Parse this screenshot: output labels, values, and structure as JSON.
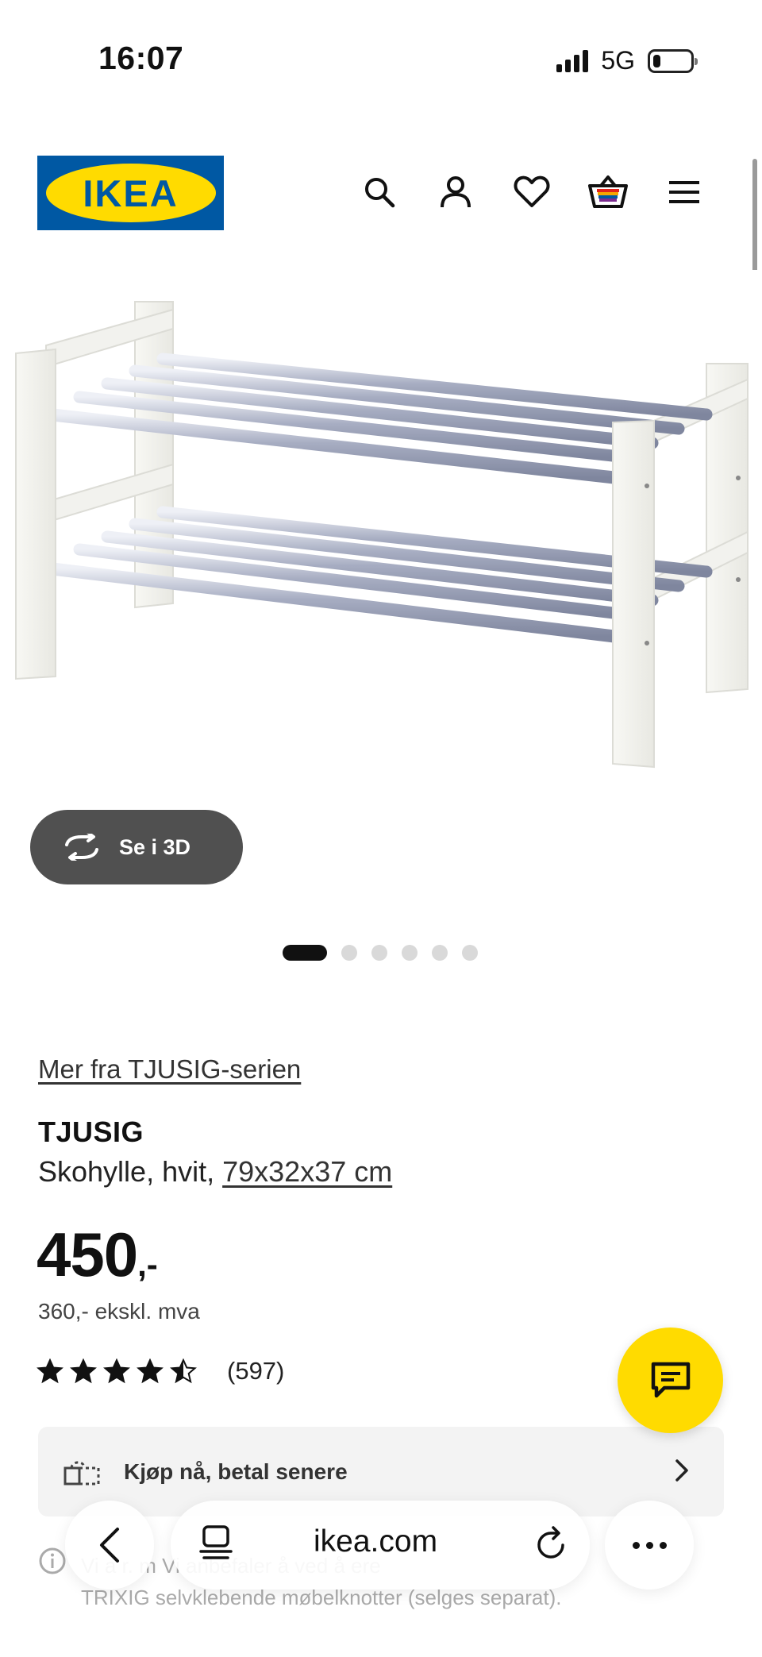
{
  "status_bar": {
    "time": "16:07",
    "network": "5G",
    "signal_bars": 4,
    "battery_level_percent": 20
  },
  "header": {
    "logo_text": "IKEA",
    "icons": [
      "search-icon",
      "profile-icon",
      "heart-icon",
      "basket-icon",
      "menu-icon"
    ]
  },
  "colors": {
    "brand_blue": "#0058a3",
    "brand_yellow": "#ffdb00",
    "button_dark": "#505050"
  },
  "gallery": {
    "see_3d_label": "Se i 3D",
    "total_images": 6,
    "current_index": 1
  },
  "product": {
    "series_link": "Mer fra TJUSIG-serien",
    "name": "TJUSIG",
    "description_prefix": "Skohylle, hvit, ",
    "dimensions": "79x32x37 cm",
    "price_main": "450",
    "price_suffix": ",-",
    "price_ex_vat": "360,- ekskl. mva",
    "rating_stars": 4.5,
    "rating_count": "(597)"
  },
  "payment": {
    "label": "Kjøp nå, betal senere"
  },
  "info_note": {
    "line1": "Vi a r.  m  Vi anbefaler å  ved å  ere",
    "line2": "TRIXIG selvklebende møbelknotter (selges separat)."
  },
  "browser": {
    "url": "ikea.com"
  }
}
